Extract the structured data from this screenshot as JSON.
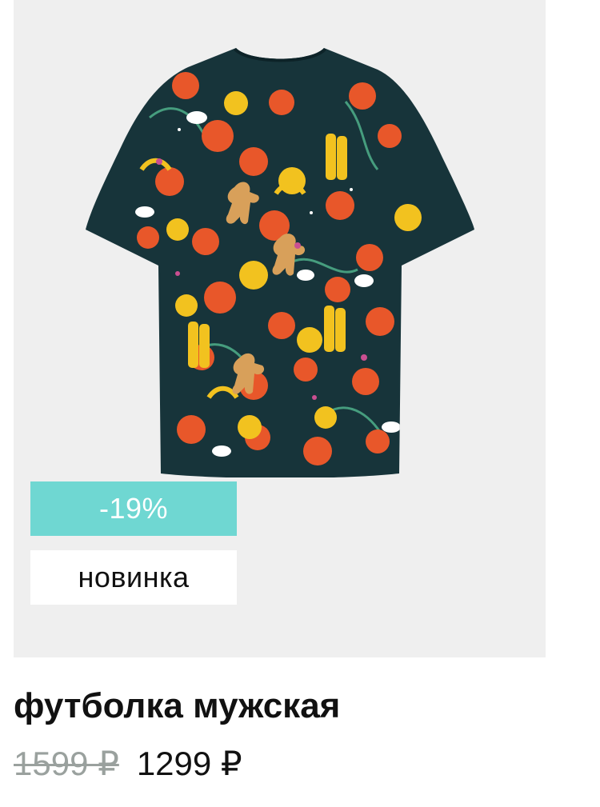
{
  "product": {
    "image_alt": "футболка мужская",
    "discount_badge": "-19%",
    "new_badge": "новинка",
    "title": "футболка мужская",
    "old_price": "1599 ₽",
    "new_price": "1299 ₽"
  },
  "colors": {
    "image_background": "#efefef",
    "discount_badge_bg": "#6fd7d2",
    "shirt_base": "#17343a",
    "shirt_orange": "#e8572a",
    "shirt_yellow": "#f2c21f",
    "shirt_green": "#4fb08b"
  },
  "icons": {
    "product_photo": "patterned-t-shirt-image"
  }
}
